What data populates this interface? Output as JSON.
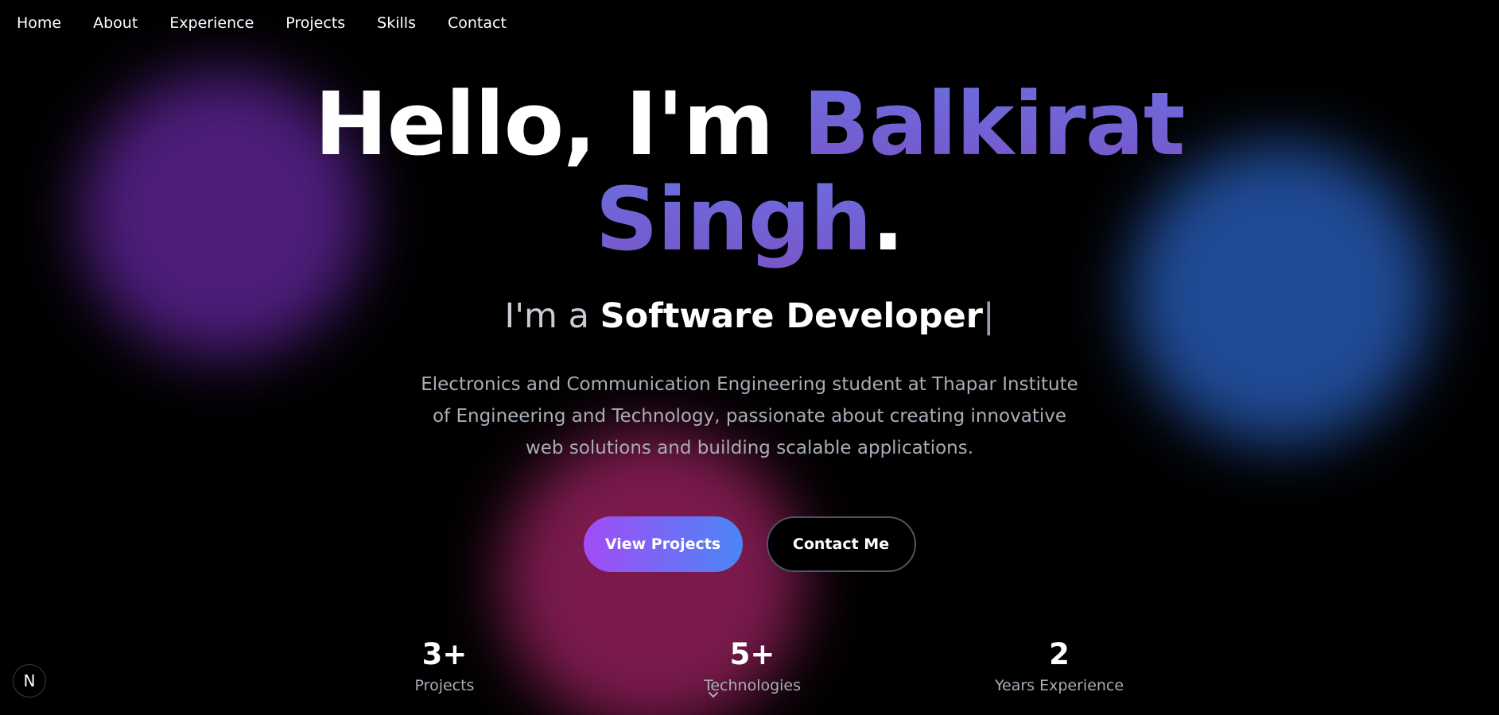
{
  "nav": {
    "items": [
      "Home",
      "About",
      "Experience",
      "Projects",
      "Skills",
      "Contact"
    ]
  },
  "hero": {
    "greeting": "Hello, I'm ",
    "name_line1": "Balkirat",
    "name_line2": "Singh",
    "period": ".",
    "role_prefix": "I'm a ",
    "role_title": "Software Developer",
    "cursor": "|",
    "description": "Electronics and Communication Engineering student at Thapar Institute of Engineering and Technology, passionate about creating innovative web solutions and building scalable applications.",
    "primary_button": "View Projects",
    "secondary_button": "Contact Me"
  },
  "stats": [
    {
      "value": "3+",
      "label": "Projects"
    },
    {
      "value": "5+",
      "label": "Technologies"
    },
    {
      "value": "2",
      "label": "Years Experience"
    }
  ],
  "badge": {
    "letter": "N"
  },
  "colors": {
    "background": "#000000",
    "name_gradient_start": "#6a6ee0",
    "name_gradient_end": "#7a56c8",
    "button_gradient_start": "#a24cf5",
    "button_gradient_end": "#4a86f6",
    "blob_purple": "#4c1d7a",
    "blob_blue": "#1f4a94",
    "blob_pink": "#7a1a4c"
  },
  "icons": {
    "badge": "next-logo-icon",
    "scroll": "chevron-down-icon"
  }
}
